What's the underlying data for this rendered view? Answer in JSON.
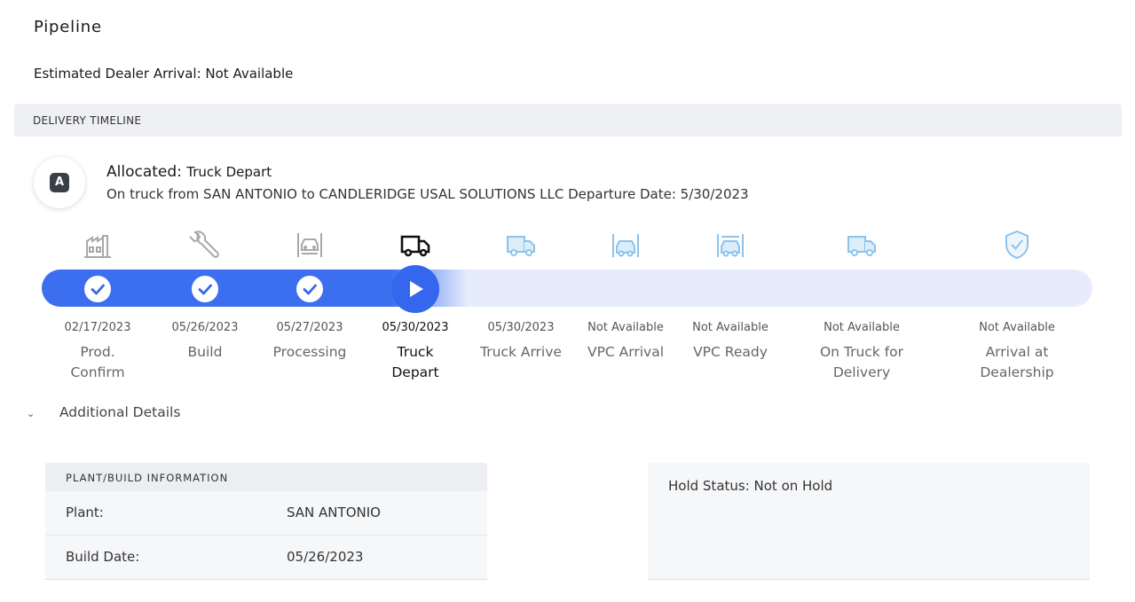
{
  "page": {
    "title": "Pipeline",
    "eta_label": "Estimated Dealer Arrival: Not Available"
  },
  "timeline": {
    "header": "DELIVERY TIMELINE",
    "badge": "A",
    "state": "Allocated:",
    "current_step": "Truck Depart",
    "description": "On truck from SAN ANTONIO to CANDLERIDGE USAL SOLUTIONS LLC Departure Date: 5/30/2023",
    "progress_step_index": 3,
    "steps": [
      {
        "date": "02/17/2023",
        "label": "Prod. Confirm",
        "status": "completed",
        "icon": "factory-icon"
      },
      {
        "date": "05/26/2023",
        "label": "Build",
        "status": "completed",
        "icon": "wrench-icon"
      },
      {
        "date": "05/27/2023",
        "label": "Processing",
        "status": "completed",
        "icon": "car-lift-icon"
      },
      {
        "date": "05/30/2023",
        "label": "Truck Depart",
        "status": "current",
        "icon": "truck-icon"
      },
      {
        "date": "05/30/2023",
        "label": "Truck Arrive",
        "status": "upcoming",
        "icon": "truck-arrive-icon"
      },
      {
        "date": "Not Available",
        "label": "VPC Arrival",
        "status": "upcoming",
        "icon": "vpc-arrival-icon"
      },
      {
        "date": "Not Available",
        "label": "VPC Ready",
        "status": "upcoming",
        "icon": "vpc-ready-icon"
      },
      {
        "date": "Not Available",
        "label": "On Truck for Delivery",
        "status": "upcoming",
        "icon": "delivery-truck-icon"
      },
      {
        "date": "Not Available",
        "label": "Arrival at Dealership",
        "status": "upcoming",
        "icon": "shield-check-icon"
      }
    ]
  },
  "details": {
    "toggle_label": "Additional Details",
    "plant_header": "PLANT/BUILD INFORMATION",
    "plant_label": "Plant:",
    "plant_value": "SAN ANTONIO",
    "build_date_label": "Build Date:",
    "build_date_value": "05/26/2023",
    "hold_status": "Hold Status: Not on Hold"
  },
  "colors": {
    "accent": "#3567ee",
    "track_bg": "#e6ecfc",
    "upcoming_icon": "#8cc3ea",
    "completed_icon": "#a8a8a8"
  }
}
